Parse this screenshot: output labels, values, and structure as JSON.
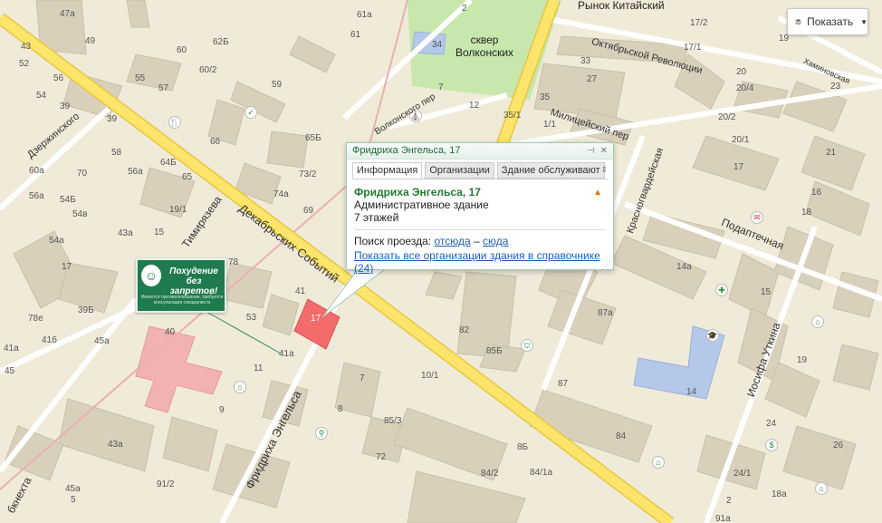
{
  "show_button": {
    "label": "Показать",
    "icon": "layers-icon"
  },
  "balloon": {
    "header_title": "Фридриха Энгельса, 17",
    "pin_icon": "pin-icon",
    "close_icon": "close-icon",
    "tabs": [
      "Информация",
      "Организации",
      "Здание обслуживают"
    ],
    "title": "Фридриха Энгельса, 17",
    "building_type": "Административное здание",
    "floors": "7 этажей",
    "route_label": "Поиск проезда:",
    "route_from": "отсюда",
    "route_dash": "–",
    "route_to": "сюда",
    "all_orgs_link": "Показать все организации здания в справочнике (24)"
  },
  "ad": {
    "title": "Похудение без запретов!",
    "fine_print": "Имеются противопоказания, требуется консультация специалиста"
  },
  "places": {
    "rynok": "Рынок  Китайский",
    "skver": "сквер\nВолконских",
    "highlighted_building": "17"
  },
  "streets": {
    "dekabrskikh": "Декабрьских Событий",
    "engelsa": "Фридриха Энгельса",
    "timiryazeva": "Тимирязева",
    "dzerzhinskogo": "Дзержинского",
    "volkonskogo": "Волконского пер",
    "militseyskiy": "Милицейский пер",
    "oktyabrskoy": "Октябрьской Революции",
    "krasnogvardeyskaya": "Красногвардейская",
    "podgornaya": "Подгорная",
    "podaptechnaya": "Подаптечная",
    "iosifa": "Иосифа Уткина",
    "khaminovskaya": "Хаминовская",
    "libkhekhta": "бкнехта"
  },
  "house_numbers": [
    "47а",
    "49",
    "43",
    "39",
    "52",
    "56",
    "54",
    "55",
    "57",
    "60",
    "60/2",
    "62Б",
    "61а",
    "61",
    "59",
    "17/1",
    "17/2",
    "19",
    "20",
    "20/1",
    "20/2",
    "20/4",
    "21",
    "23",
    "25",
    "27",
    "33",
    "34",
    "7",
    "12",
    "35/1",
    "35",
    "1/1",
    "2",
    "7/1",
    "39",
    "58",
    "56а",
    "64Б",
    "64",
    "66",
    "65",
    "70",
    "60а",
    "56а",
    "54Б",
    "54в",
    "54а",
    "43а",
    "19/1",
    "15",
    "17",
    "41",
    "78",
    "74а",
    "69",
    "73/2",
    "65Б",
    "53",
    "78е",
    "41б",
    "41а",
    "39Б",
    "45а",
    "42",
    "45",
    "40",
    "41а",
    "11",
    "9",
    "7",
    "8",
    "10/1",
    "82",
    "85Б",
    "85/3",
    "8Б",
    "84/1а",
    "84/2",
    "84",
    "87",
    "87а",
    "14а",
    "14",
    "15",
    "17",
    "16",
    "18",
    "19",
    "26",
    "24",
    "24/1",
    "18а",
    "2",
    "91а",
    "91/2",
    "5",
    "43а",
    "45а",
    "72",
    "3"
  ],
  "colors": {
    "background": "#f0ebd9",
    "building": "#d9d0bc",
    "main_road": "#fce56a",
    "highlight": "#f36b6b",
    "hospital": "#f2b2b2",
    "school": "#b5c8ea",
    "park": "#c7e7ad",
    "balloon_title": "#217a2f",
    "link": "#1a5fb4"
  }
}
